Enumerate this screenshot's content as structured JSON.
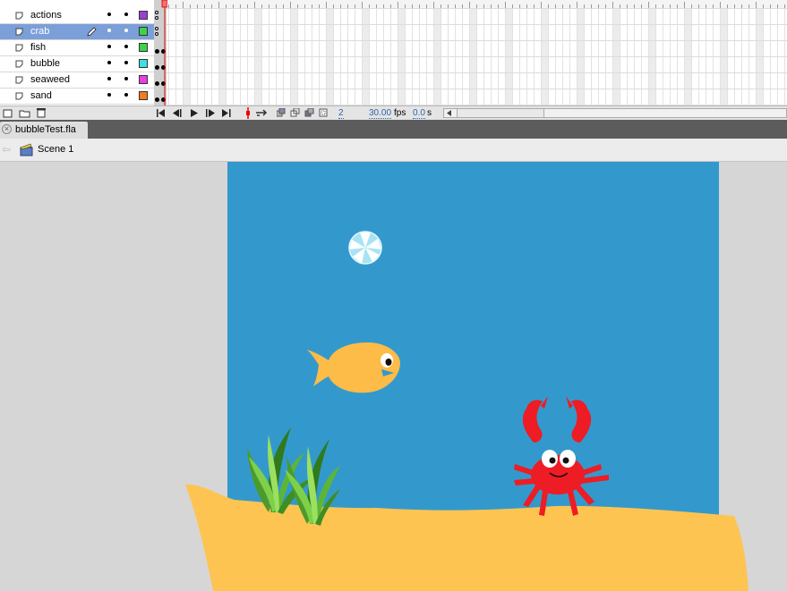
{
  "timeline": {
    "layers": [
      {
        "name": "actions",
        "color": "#9b3fd1",
        "selected": false
      },
      {
        "name": "crab",
        "color": "#3fd14a",
        "selected": true
      },
      {
        "name": "fish",
        "color": "#3fd14a",
        "selected": false
      },
      {
        "name": "bubble",
        "color": "#3fe0e0",
        "selected": false
      },
      {
        "name": "seaweed",
        "color": "#e640e6",
        "selected": false
      },
      {
        "name": "sand",
        "color": "#f07d1f",
        "selected": false
      }
    ],
    "controls": {
      "current_frame": "2",
      "fps_value": "30.00",
      "fps_unit": "fps",
      "time_value": "0.0",
      "time_unit": "s"
    }
  },
  "document": {
    "tab_title": "bubbleTest.fla",
    "close_glyph": "×",
    "scene_label": "Scene 1"
  },
  "stage": {
    "background_color": "#3399cc",
    "sand_color": "#fdc452",
    "fish_color": "#fdbb48",
    "crab_color": "#ee1c24"
  },
  "icons": [
    "layer-icon",
    "pencil-icon",
    "new-layer-icon",
    "new-folder-icon",
    "trash-icon",
    "scene-clapper-icon",
    "close-icon"
  ]
}
